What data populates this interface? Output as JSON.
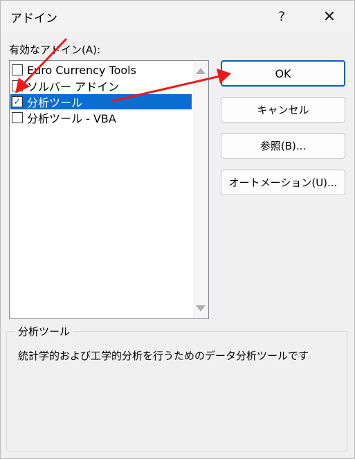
{
  "window": {
    "title": "アドイン",
    "help_label": "?",
    "close_label": "✕"
  },
  "addins": {
    "label": "有効なアドイン(A):",
    "items": [
      {
        "label": "Euro Currency Tools",
        "checked": false,
        "selected": false
      },
      {
        "label": "ソルバー アドイン",
        "checked": false,
        "selected": false
      },
      {
        "label": "分析ツール",
        "checked": true,
        "selected": true
      },
      {
        "label": "分析ツール - VBA",
        "checked": false,
        "selected": false
      }
    ]
  },
  "buttons": {
    "ok": "OK",
    "cancel": "キャンセル",
    "browse": "参照(B)...",
    "automation": "オートメーション(U)..."
  },
  "description": {
    "title": "分析ツール",
    "text": "統計学的および工学的分析を行うためのデータ分析ツールです"
  },
  "colors": {
    "selection": "#0a6ed1",
    "annotation_arrow": "#e8191b"
  }
}
